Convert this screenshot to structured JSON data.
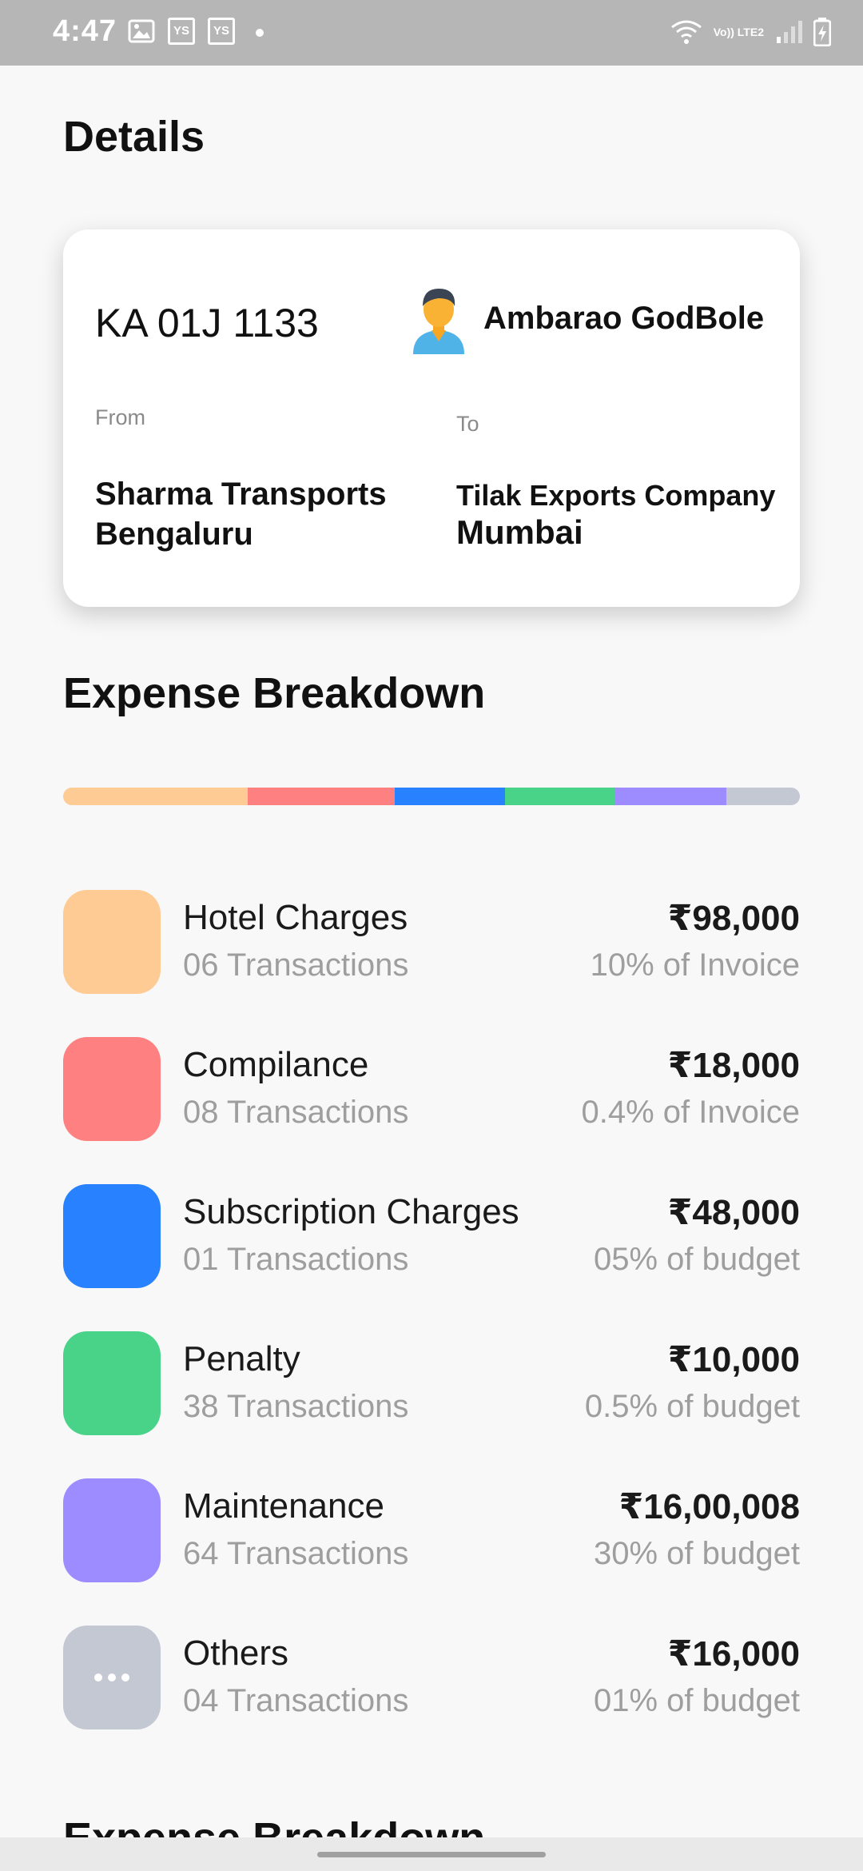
{
  "status_bar": {
    "time": "4:47",
    "app_icon_1": "YS",
    "app_icon_2": "YS",
    "network": "Vo)) LTE2"
  },
  "page": {
    "title": "Details"
  },
  "trip": {
    "vehicle_number": "KA 01J 1133",
    "driver_name": "Ambarao GodBole",
    "from_label": "From",
    "to_label": "To",
    "from_company": "Sharma Transports",
    "from_city": "Bengaluru",
    "to_company": "Tilak Exports Company",
    "to_city": "Mumbai"
  },
  "expense": {
    "title": "Expense Breakdown",
    "second_title": "Expense Breakdown",
    "bar_segments": [
      {
        "color": "#FFCB94",
        "share": 0.25
      },
      {
        "color": "#FF8080",
        "share": 0.2
      },
      {
        "color": "#2882FF",
        "share": 0.15
      },
      {
        "color": "#48D389",
        "share": 0.15
      },
      {
        "color": "#9C8CFF",
        "share": 0.15
      },
      {
        "color": "#C3C8D2",
        "share": 0.1
      }
    ],
    "items": [
      {
        "name": "Hotel Charges",
        "transactions": "06 Transactions",
        "amount": "₹98,000",
        "percent": "10% of Invoice",
        "color": "#FFCB94"
      },
      {
        "name": "Compilance",
        "transactions": "08 Transactions",
        "amount": "₹18,000",
        "percent": "0.4% of Invoice",
        "color": "#FF8080"
      },
      {
        "name": "Subscription Charges",
        "transactions": "01 Transactions",
        "amount": "₹48,000",
        "percent": "05% of budget",
        "color": "#2882FF"
      },
      {
        "name": "Penalty",
        "transactions": "38 Transactions",
        "amount": "₹10,000",
        "percent": "0.5% of budget",
        "color": "#48D389"
      },
      {
        "name": "Maintenance",
        "transactions": "64 Transactions",
        "amount": "₹16,00,008",
        "percent": "30% of budget",
        "color": "#9C8CFF"
      },
      {
        "name": "Others",
        "transactions": "04 Transactions",
        "amount": "₹16,000",
        "percent": "01% of budget",
        "color": "#C3C8D2",
        "icon": "more-icon"
      }
    ]
  }
}
